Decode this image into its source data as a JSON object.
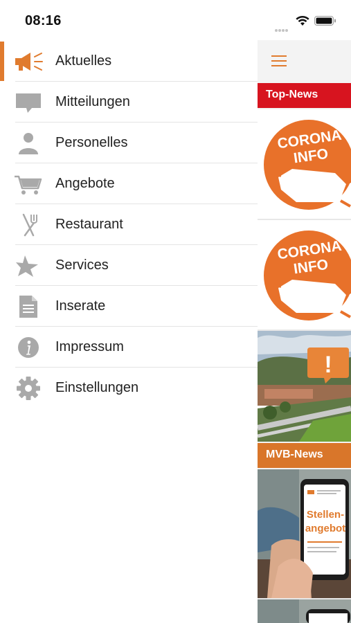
{
  "status_bar": {
    "time": "08:16"
  },
  "menu": {
    "items": [
      {
        "label": "Aktuelles",
        "icon": "megaphone-icon",
        "active": true
      },
      {
        "label": "Mitteilungen",
        "icon": "speech-bubble-icon"
      },
      {
        "label": "Personelles",
        "icon": "person-icon"
      },
      {
        "label": "Angebote",
        "icon": "shopping-cart-icon"
      },
      {
        "label": "Restaurant",
        "icon": "fork-knife-icon"
      },
      {
        "label": "Services",
        "icon": "star-icon"
      },
      {
        "label": "Inserate",
        "icon": "document-icon"
      },
      {
        "label": "Impressum",
        "icon": "info-icon"
      },
      {
        "label": "Einstellungen",
        "icon": "gear-icon"
      }
    ]
  },
  "panel": {
    "top_news_label": "Top-News",
    "mvb_news_label": "MVB-News",
    "cards": [
      {
        "badge_line1": "CORONA",
        "badge_line2": "INFO"
      },
      {
        "badge_line1": "CORONA",
        "badge_line2": "INFO"
      },
      {
        "alert_symbol": "!"
      },
      {
        "phone_text_line1": "Stellen-",
        "phone_text_line2": "angebot"
      }
    ]
  },
  "colors": {
    "accent": "#e07b2e",
    "red": "#d7141f",
    "icon_gray": "#a9a9a9"
  }
}
